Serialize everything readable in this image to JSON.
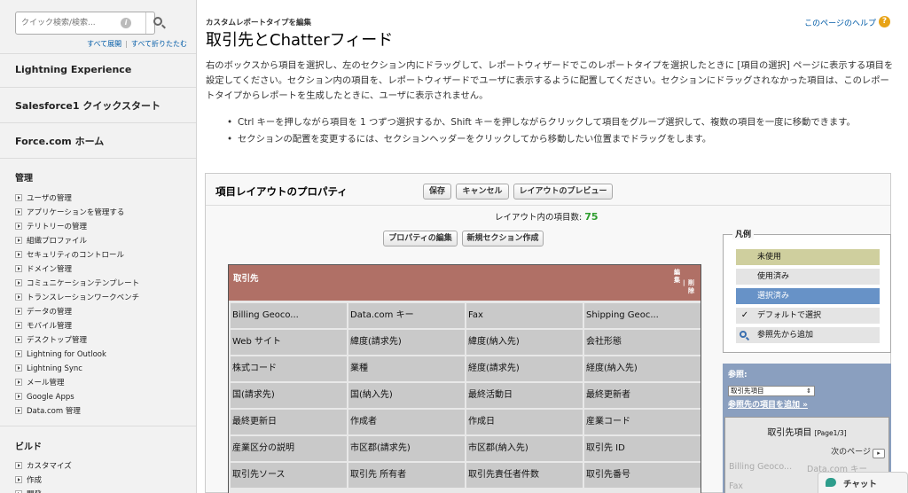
{
  "sidebar": {
    "search_placeholder": "クイック検索/検索...",
    "expand_all": "すべて展開",
    "collapse_all": "すべて折りたたむ",
    "lightning_experience": "Lightning Experience",
    "salesforce1": "Salesforce1 クイックスタート",
    "force_home": "Force.com ホーム",
    "admin_title": "管理",
    "admin_items": [
      "ユーザの管理",
      "アプリケーションを管理する",
      "テリトリーの管理",
      "組織プロファイル",
      "セキュリティのコントロール",
      "ドメイン管理",
      "コミュニケーションテンプレート",
      "トランスレーションワークベンチ",
      "データの管理",
      "モバイル管理",
      "デスクトップ管理",
      "Lightning for Outlook",
      "Lightning Sync",
      "メール管理",
      "Google Apps",
      "Data.com 管理"
    ],
    "build_title": "ビルド",
    "build_items": [
      "カスタマイズ",
      "作成",
      "開発"
    ]
  },
  "header": {
    "breadcrumb": "カスタムレポートタイプを編集",
    "title": "取引先とChatterフィード",
    "help_link": "このページのヘルプ",
    "help_icon": "?"
  },
  "intro": "右のボックスから項目を選択し、左のセクション内にドラッグして、レポートウィザードでこのレポートタイプを選択したときに [項目の選択] ページに表示する項目を設定してください。セクション内の項目を、レポートウィザードでユーザに表示するように配置してください。セクションにドラッグされなかった項目は、このレポートタイプからレポートを生成したときに、ユーザに表示されません。",
  "tips": [
    "Ctrl キーを押しながら項目を 1 つずつ選択するか、Shift キーを押しながらクリックして項目をグループ選択して、複数の項目を一度に移動できます。",
    "セクションの配置を変更するには、セクションヘッダーをクリックしてから移動したい位置までドラッグをします。"
  ],
  "panel": {
    "title": "項目レイアウトのプロパティ",
    "save": "保存",
    "cancel": "キャンセル",
    "preview": "レイアウトのプレビュー",
    "field_count_label": "レイアウト内の項目数:",
    "field_count": "75",
    "edit_props": "プロパティの編集",
    "new_section": "新規セクション作成"
  },
  "section": {
    "title": "取引先",
    "edit": "編集",
    "delete": "削除",
    "sep": "|",
    "fields": [
      "Billing Geoco...",
      "Data.com キー",
      "Fax",
      "Shipping Geoc...",
      "Web サイト",
      "緯度(請求先)",
      "緯度(納入先)",
      "会社形態",
      "株式コード",
      "業種",
      "経度(請求先)",
      "経度(納入先)",
      "国(請求先)",
      "国(納入先)",
      "最終活動日",
      "最終更新者",
      "最終更新日",
      "作成者",
      "作成日",
      "産業コード",
      "産業区分の説明",
      "市区郡(請求先)",
      "市区郡(納入先)",
      "取引先 ID",
      "取引先ソース",
      "取引先 所有者",
      "取引先責任者件数",
      "取引先番号"
    ]
  },
  "legend": {
    "title": "凡例",
    "unused": "未使用",
    "used": "使用済み",
    "selected": "選択済み",
    "default_selected": "デフォルトで選択",
    "lookup_add": "参照先から追加",
    "check_glyph": "✓"
  },
  "reference": {
    "label": "参照:",
    "select_value": "取引先項目",
    "add_link": "参照先の項目を追加 »",
    "box_title": "取引先項目",
    "page": "[Page1/3]",
    "next": "次のページ",
    "next_glyph": "▸",
    "row1a": "Billing Geoco...",
    "row1b": "Data.com キー",
    "row2": "Fax"
  },
  "chat": {
    "label": "チャット"
  },
  "colors": {
    "section_header": "#b07066",
    "link": "#015ba7",
    "field_count": "#2e9d2e",
    "legend_unused": "#cfcf9e",
    "legend_selected": "#6792c7",
    "reference_panel": "#8a9fbf"
  }
}
